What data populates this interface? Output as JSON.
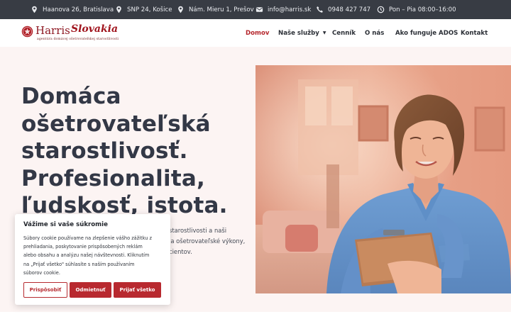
{
  "topbar": {
    "items": [
      {
        "icon": "location-pin-icon",
        "text": "Haanova 26, Bratislava"
      },
      {
        "icon": "location-pin-icon",
        "text": "SNP 24, Košice"
      },
      {
        "icon": "location-pin-icon",
        "text": "Nám. Mieru 1, Prešov"
      },
      {
        "icon": "envelope-icon",
        "text": "info@harris.sk"
      },
      {
        "icon": "phone-icon",
        "text": "0948 427 747"
      },
      {
        "icon": "clock-icon",
        "text": "Pon – Pia 08:00–16:00"
      }
    ]
  },
  "logo": {
    "word1": "Harris",
    "word2": "Slovakia",
    "tagline": "agentúra domácej ošetrovateľskej starostlivosti"
  },
  "nav": {
    "items": [
      {
        "label": "Domov",
        "active": true
      },
      {
        "label": "Naše služby",
        "dropdown": true
      },
      {
        "label": "Cenník"
      },
      {
        "label": "O nás"
      },
      {
        "label": "Ako funguje ADOS"
      },
      {
        "label": "Kontakt"
      }
    ]
  },
  "hero": {
    "title_lines": [
      "Domáca",
      "ošetrovateľská",
      "starostlivosť.",
      "Profesionalita,",
      "ľudskosť, istota."
    ],
    "text_lines": [
      "starostlivosti a naši",
      "ia ošetrovateľské výkony,",
      "cientov."
    ]
  },
  "cookie": {
    "title": "Vážime si vaše súkromie",
    "body_lines": [
      "Súbory cookie používame na zlepšenie vášho zážitku z",
      "prehliadania, poskytovanie prispôsobených reklám",
      "alebo obsahu a analýzu našej návštevnosti. Kliknutím",
      "na „Prijať všetko\" súhlasíte s naším používaním",
      "súborov cookie."
    ],
    "customize_label": "Prispôsobiť",
    "reject_label": "Odmietnuť",
    "accept_label": "Prijať všetko"
  },
  "colors": {
    "brand_red": "#b8292f",
    "topbar_bg": "#383c44",
    "hero_bg": "#fcf4f3",
    "heading": "#333846"
  }
}
